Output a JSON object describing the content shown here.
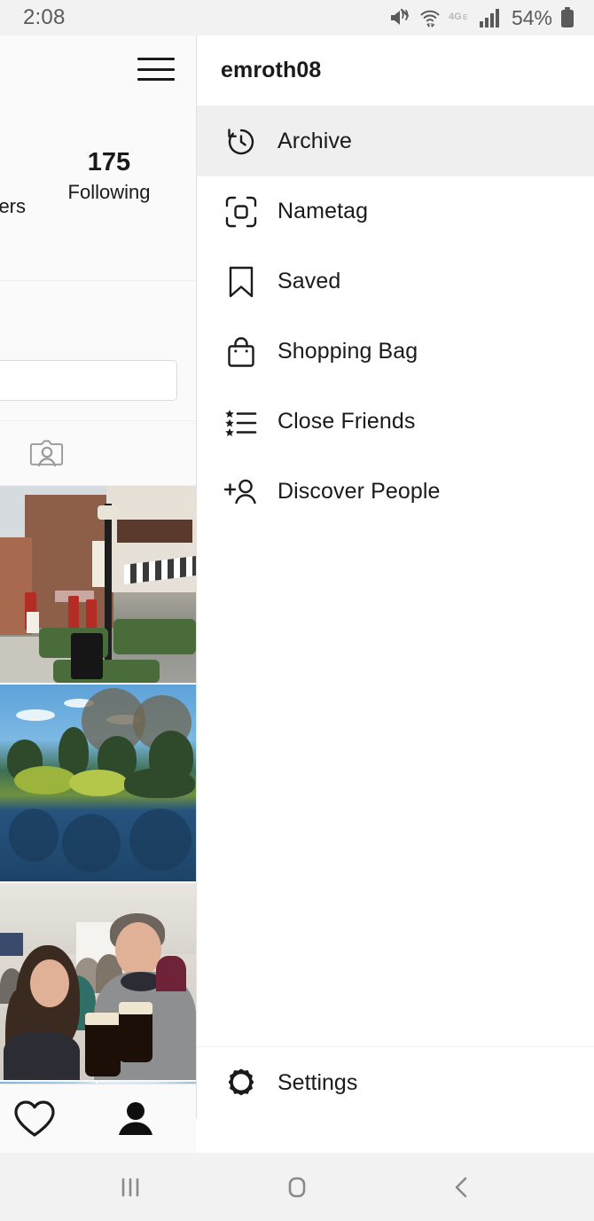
{
  "status_bar": {
    "time": "2:08",
    "battery_percent": "54%",
    "icons": [
      "mute-vibrate-icon",
      "wifi-icon",
      "4g-lte-icon",
      "signal-bars-icon",
      "battery-icon"
    ],
    "network_label": "4G",
    "background": "#f2f2f2",
    "text_color": "#5a5a5a"
  },
  "profile": {
    "menu_icon": "hamburger-icon",
    "stats": [
      {
        "value": "175",
        "label": "Following"
      }
    ],
    "followers_clipped_label": "ers",
    "edit_profile_label": "",
    "tabs": [
      {
        "name": "tagged-photos-tab",
        "icon": "person-card-icon"
      }
    ],
    "photos": [
      {
        "name": "street-scene-photo",
        "alt": "Brick storefront street with lamppost, striped awning and red umbrellas"
      },
      {
        "name": "pond-landscape-photo",
        "alt": "Pond with palm trees, bare trees and blue sky reflection"
      },
      {
        "name": "guinness-selfie-photo",
        "alt": "Two people smiling holding pints of Guinness indoors"
      },
      {
        "name": "sky-palm-photo",
        "alt": "Partial row showing blue sky and palm fronds"
      }
    ]
  },
  "drawer": {
    "username": "emroth08",
    "menu_items": [
      {
        "label": "Archive",
        "icon": "archive-clock-icon",
        "active": true
      },
      {
        "label": "Nametag",
        "icon": "nametag-icon",
        "active": false
      },
      {
        "label": "Saved",
        "icon": "bookmark-icon",
        "active": false
      },
      {
        "label": "Shopping Bag",
        "icon": "shopping-bag-icon",
        "active": false
      },
      {
        "label": "Close Friends",
        "icon": "close-friends-icon",
        "active": false
      },
      {
        "label": "Discover People",
        "icon": "discover-people-icon",
        "active": false
      }
    ],
    "settings": {
      "label": "Settings",
      "icon": "gear-icon"
    },
    "active_highlight_color": "#efefef",
    "background": "#ffffff"
  },
  "bottom_tab_bar": {
    "tabs": [
      {
        "name": "activity-tab",
        "icon": "heart-icon",
        "active": false
      },
      {
        "name": "profile-tab",
        "icon": "person-icon",
        "active": true
      }
    ]
  },
  "android_nav": {
    "buttons": [
      {
        "name": "recents-button",
        "icon": "recents-bars-icon"
      },
      {
        "name": "home-button",
        "icon": "home-square-icon"
      },
      {
        "name": "back-button",
        "icon": "back-chevron-icon"
      }
    ],
    "background": "#f2f2f2",
    "icon_color": "#8a8a8a"
  }
}
